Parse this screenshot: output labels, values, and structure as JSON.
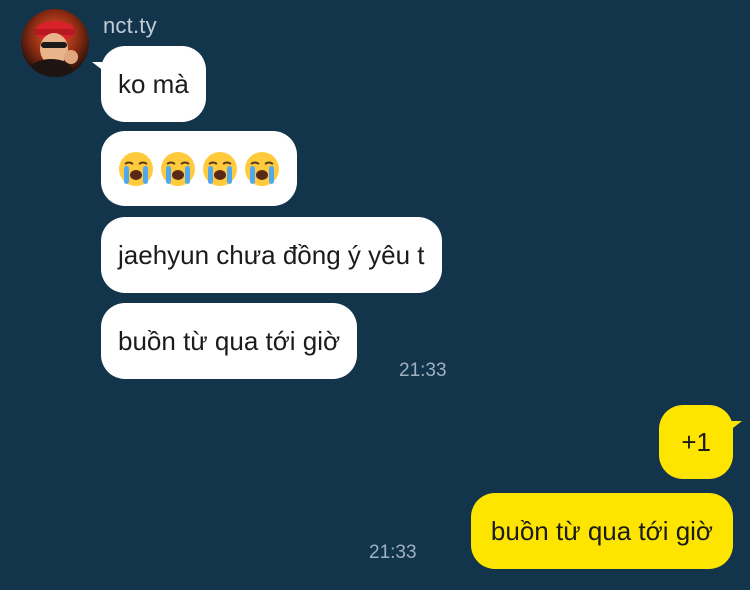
{
  "chat": {
    "sender": {
      "name": "nct.ty"
    },
    "incoming": [
      {
        "text": "ko mà"
      },
      {
        "emoji": [
          "loudly-crying-face",
          "loudly-crying-face",
          "loudly-crying-face",
          "loudly-crying-face"
        ]
      },
      {
        "text": "jaehyun chưa đồng ý yêu t"
      },
      {
        "text": "buồn từ qua tới giờ",
        "time": "21:33"
      }
    ],
    "outgoing": [
      {
        "text": "+1"
      },
      {
        "text": "buồn từ qua tới giờ",
        "time": "21:33"
      }
    ]
  },
  "colors": {
    "background": "#13354c",
    "incoming_bubble": "#ffffff",
    "outgoing_bubble": "#fee500",
    "timestamp": "#9fb0bf"
  }
}
